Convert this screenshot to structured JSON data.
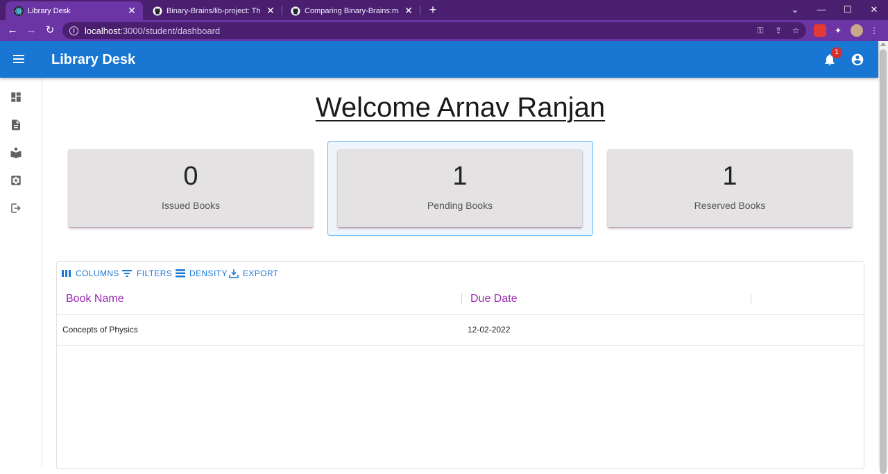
{
  "browser": {
    "tabs": [
      {
        "title": "Library Desk",
        "active": true
      },
      {
        "title": "Binary-Brains/lib-project: This Pr",
        "active": false
      },
      {
        "title": "Comparing Binary-Brains:main...a",
        "active": false
      }
    ],
    "url_host": "localhost",
    "url_path": ":3000/student/dashboard"
  },
  "app": {
    "title": "Library Desk",
    "notification_count": "1",
    "brand_color": "#1976d2"
  },
  "sidebar": {
    "items": [
      {
        "icon": "dashboard-icon"
      },
      {
        "icon": "document-icon"
      },
      {
        "icon": "book-reader-icon"
      },
      {
        "icon": "settings-icon"
      },
      {
        "icon": "logout-icon"
      }
    ]
  },
  "main": {
    "welcome": "Welcome Arnav Ranjan",
    "cards": [
      {
        "count": "0",
        "label": "Issued Books"
      },
      {
        "count": "1",
        "label": "Pending Books"
      },
      {
        "count": "1",
        "label": "Reserved Books"
      }
    ]
  },
  "grid": {
    "toolbar": {
      "columns": "COLUMNS",
      "filters": "FILTERS",
      "density": "DENSITY",
      "export": "EXPORT"
    },
    "headers": [
      "Book Name",
      "Due Date"
    ],
    "rows": [
      [
        "Concepts of Physics",
        "12-02-2022"
      ]
    ]
  }
}
